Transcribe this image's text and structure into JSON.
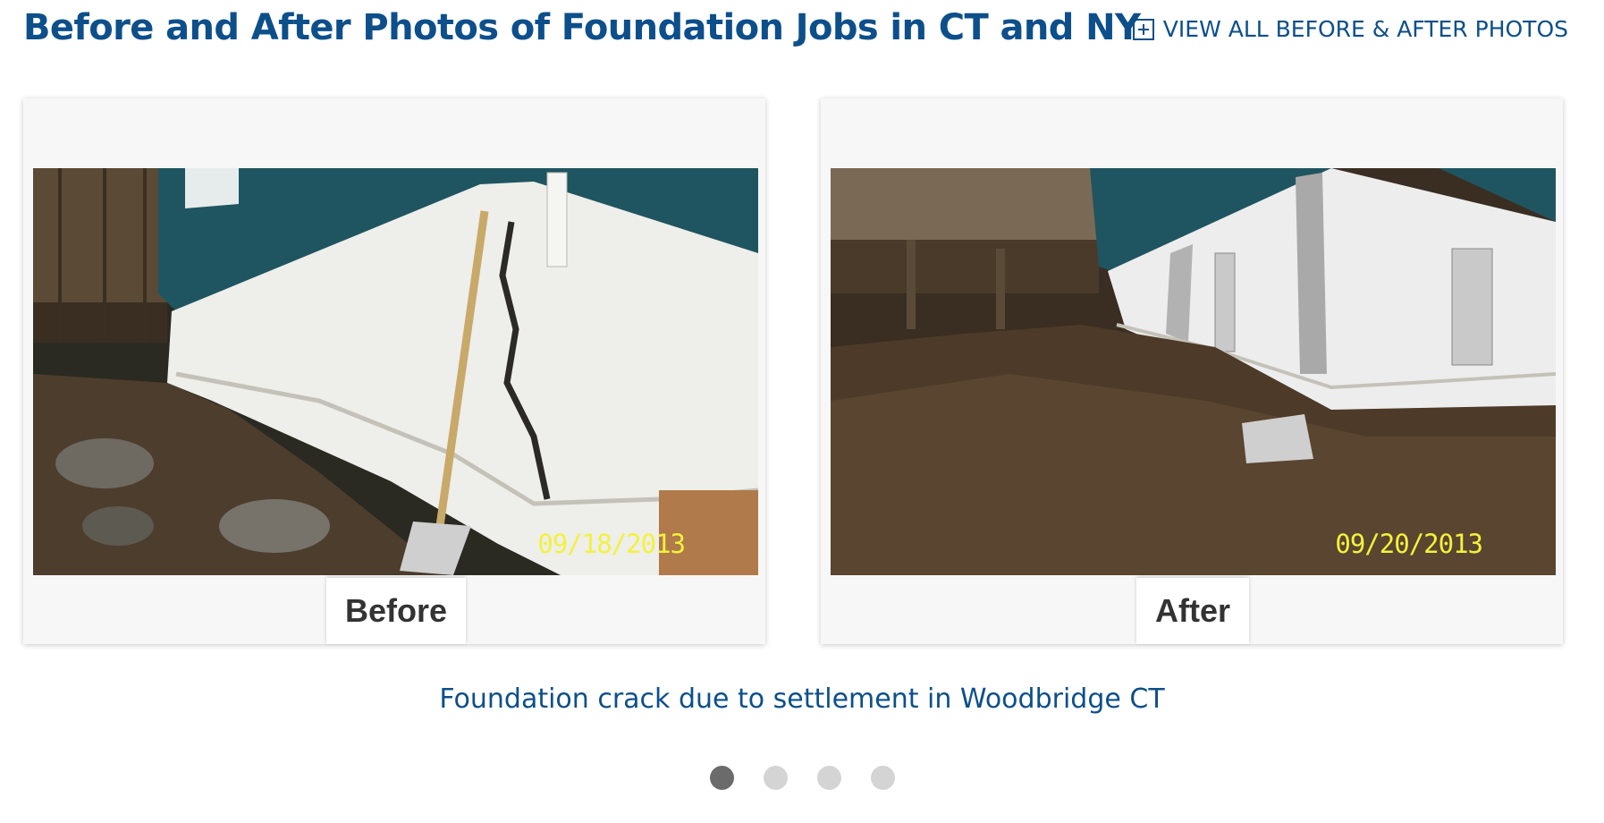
{
  "header": {
    "title": "Before and After Photos of Foundation Jobs in CT and NY",
    "view_all_label": "VIEW ALL BEFORE & AFTER PHOTOS",
    "view_all_icon": "plus-square-icon"
  },
  "slides": {
    "before": {
      "label": "Before",
      "date_stamp": "09/18/2013"
    },
    "after": {
      "label": "After",
      "date_stamp": "09/20/2013"
    },
    "caption": "Foundation crack due to settlement in Woodbridge CT"
  },
  "pagination": {
    "count": 4,
    "active_index": 0
  },
  "colors": {
    "brand_blue": "#0d4f8b",
    "date_stamp": "#f2f23c",
    "dot_active": "#6b6b6b",
    "dot_inactive": "#d4d4d4"
  }
}
